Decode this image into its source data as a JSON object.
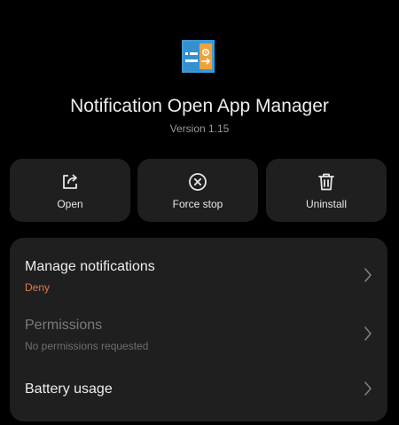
{
  "app": {
    "name": "Notification Open App Manager",
    "version": "Version 1.15",
    "icon": "app-icon"
  },
  "actions": [
    {
      "label": "Open",
      "icon": "open-external-icon"
    },
    {
      "label": "Force stop",
      "icon": "force-stop-icon"
    },
    {
      "label": "Uninstall",
      "icon": "trash-icon"
    }
  ],
  "settings": [
    {
      "title": "Manage notifications",
      "subtitle": "Deny",
      "subtitle_color": "#e07a4d",
      "disabled": false
    },
    {
      "title": "Permissions",
      "subtitle": "No permissions requested",
      "disabled": true
    },
    {
      "title": "Battery usage",
      "subtitle": "",
      "disabled": false
    }
  ],
  "colors": {
    "background": "#000000",
    "card": "#1f1f1f",
    "accent_warning": "#e07a4d",
    "disabled_text": "#7a7a7a",
    "chevron": "#7f7f7f"
  }
}
